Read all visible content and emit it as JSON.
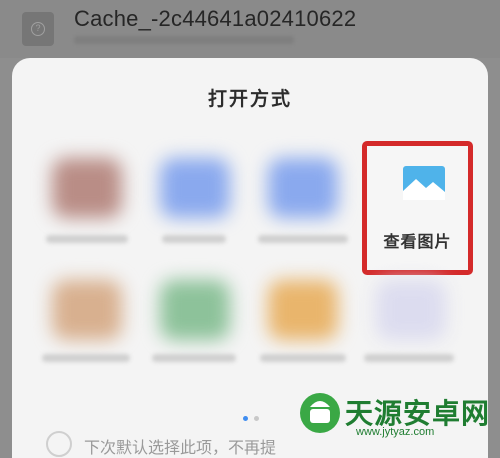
{
  "file": {
    "name": "Cache_-2c44641a02410622"
  },
  "sheet": {
    "title": "打开方式",
    "highlighted_app": {
      "label": "查看图片",
      "icon": "picture-icon"
    },
    "page_indicator": {
      "count": 2,
      "active_index": 0
    },
    "footer_text": "下次默认选择此项，不再提"
  },
  "watermark": {
    "text": "天源安卓网",
    "url": "www.jytyaz.com"
  },
  "colors": {
    "highlight_border": "#d42a2a",
    "sheet_background": "#f4f4f4",
    "dim_overlay": "#8e8e8e",
    "active_dot": "#3f8df0",
    "watermark_green": "#1f7d31"
  }
}
